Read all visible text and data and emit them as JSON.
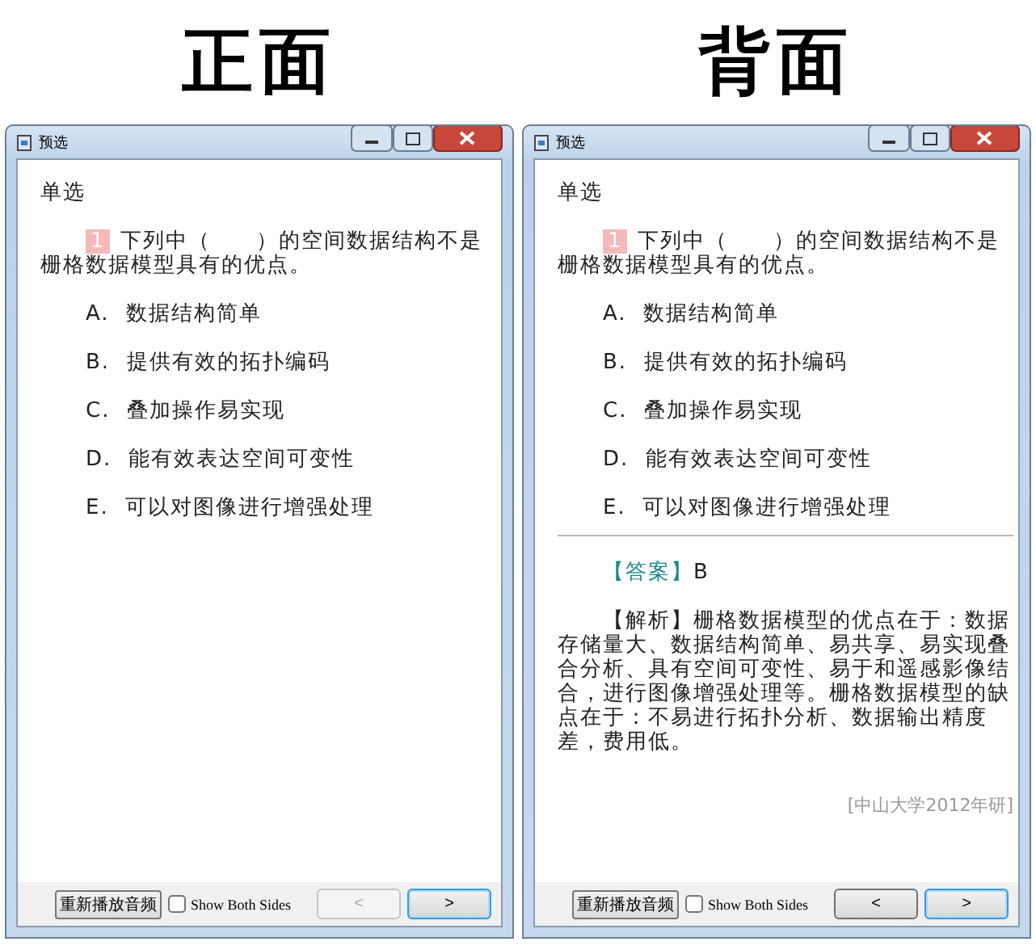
{
  "panels": [
    {
      "heading": "正面",
      "window": {
        "title": "预选",
        "question_type": "单选",
        "question": {
          "number": "1",
          "text": "下列中（　　）的空间数据结构不是栅格数据模型具有的优点。"
        },
        "options": [
          {
            "letter": "A.",
            "text": "数据结构简单"
          },
          {
            "letter": "B.",
            "text": "提供有效的拓扑编码"
          },
          {
            "letter": "C.",
            "text": "叠加操作易实现"
          },
          {
            "letter": "D.",
            "text": "能有效表达空间可变性"
          },
          {
            "letter": "E.",
            "text": "可以对图像进行增强处理"
          }
        ],
        "footer": {
          "replay_button": "重新播放音频",
          "show_both_sides": {
            "label": "Show Both Sides",
            "checked": false
          },
          "prev": {
            "label": "<",
            "disabled": true
          },
          "next": {
            "label": ">",
            "disabled": false
          }
        }
      }
    },
    {
      "heading": "背面",
      "window": {
        "title": "预选",
        "question_type": "单选",
        "question": {
          "number": "1",
          "text": "下列中（　　）的空间数据结构不是栅格数据模型具有的优点。"
        },
        "options": [
          {
            "letter": "A.",
            "text": "数据结构简单"
          },
          {
            "letter": "B.",
            "text": "提供有效的拓扑编码"
          },
          {
            "letter": "C.",
            "text": "叠加操作易实现"
          },
          {
            "letter": "D.",
            "text": "能有效表达空间可变性"
          },
          {
            "letter": "E.",
            "text": "可以对图像进行增强处理"
          }
        ],
        "answer": {
          "label": "【答案】",
          "value": "B"
        },
        "analysis": {
          "label": "【解析】",
          "text": "栅格数据模型的优点在于：数据存储量大、数据结构简单、易共享、易实现叠合分析、具有空间可变性、易于和遥感影像结合，进行图像增强处理等。栅格数据模型的缺点在于：不易进行拓扑分析、数据输出精度差，费用低。"
        },
        "source": "[中山大学2012年研]",
        "footer": {
          "replay_button": "重新播放音频",
          "show_both_sides": {
            "label": "Show Both Sides",
            "checked": false
          },
          "prev": {
            "label": "<",
            "disabled": false
          },
          "next": {
            "label": ">",
            "disabled": false
          }
        }
      }
    }
  ]
}
